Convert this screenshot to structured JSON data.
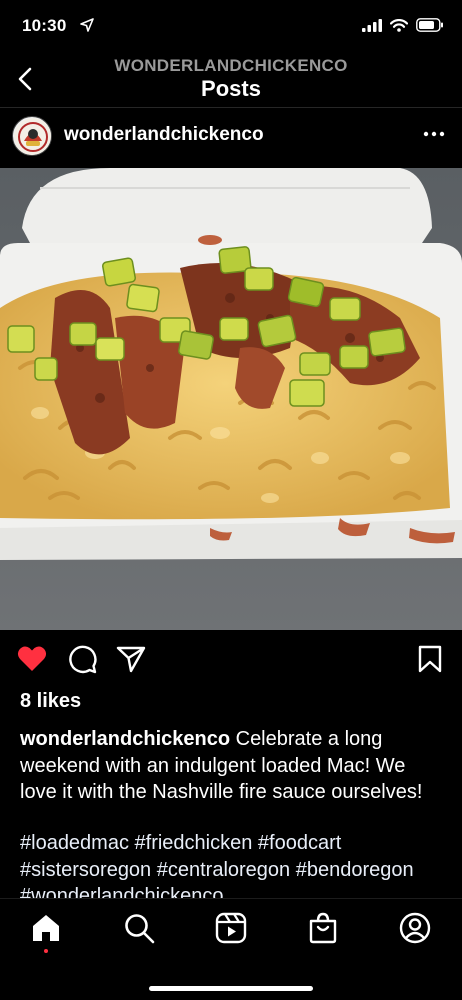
{
  "status": {
    "time": "10:30"
  },
  "nav": {
    "account": "WONDERLANDCHICKENCO",
    "title": "Posts"
  },
  "post": {
    "username": "wonderlandchickenco",
    "likes": "8 likes",
    "caption_user": "wonderlandchickenco",
    "caption_text": " Celebrate a long weekend with an indulgent loaded Mac! We love it with the Nashville fire sauce ourselves!",
    "hashtags": "#loadedmac #friedchicken #foodcart #sistersoregon #centraloregon #bendoregon #wonderlandchickenco",
    "liked": true
  },
  "colors": {
    "like_red": "#ff3040",
    "background": "#000000"
  },
  "icons": {
    "actions": [
      "heart-icon",
      "comment-icon",
      "share-icon",
      "bookmark-icon"
    ],
    "tabs": [
      "home-icon",
      "search-icon",
      "reels-icon",
      "shop-icon",
      "profile-icon"
    ]
  }
}
